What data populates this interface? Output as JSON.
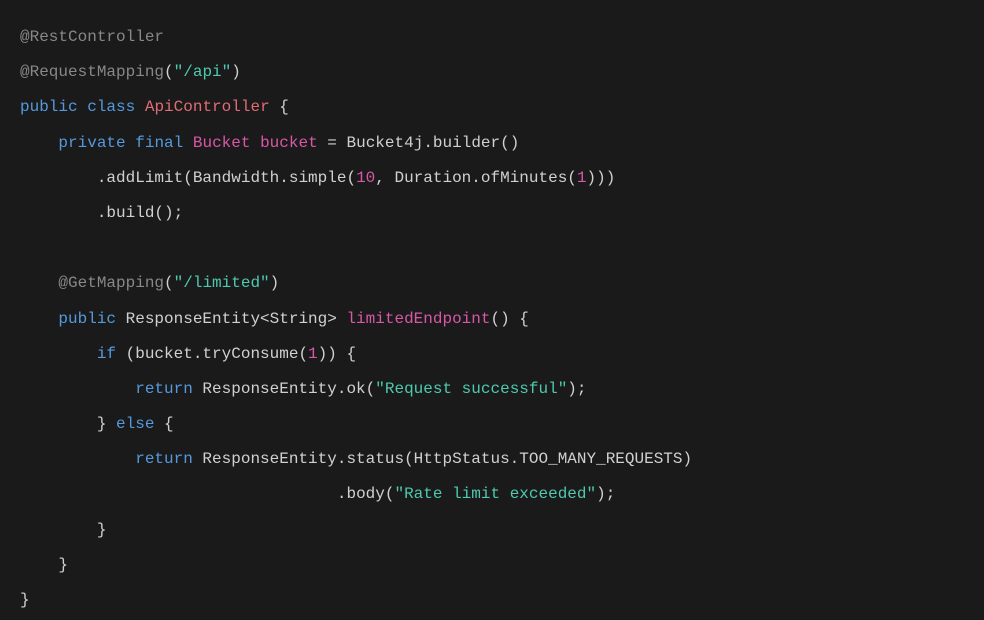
{
  "code": {
    "line1": {
      "annotation": "@RestController"
    },
    "line2": {
      "annotation": "@RequestMapping",
      "paren_open": "(",
      "string": "\"/api\"",
      "paren_close": ")"
    },
    "line3": {
      "keyword_public": "public",
      "keyword_class": "class",
      "class_name": "ApiController",
      "brace": " {"
    },
    "line4": {
      "indent": "    ",
      "keyword_private": "private",
      "keyword_final": "final",
      "type": "Bucket",
      "variable": "bucket",
      "equals": " = ",
      "builder": "Bucket4j.builder()"
    },
    "line5": {
      "indent": "        ",
      "method": ".addLimit(Bandwidth.simple(",
      "num1": "10",
      "mid": ", Duration.ofMinutes(",
      "num2": "1",
      "end": ")))"
    },
    "line6": {
      "indent": "        ",
      "method": ".build();"
    },
    "line8": {
      "indent": "    ",
      "annotation": "@GetMapping",
      "paren_open": "(",
      "string": "\"/limited\"",
      "paren_close": ")"
    },
    "line9": {
      "indent": "    ",
      "keyword_public": "public",
      "type": " ResponseEntity<String> ",
      "method_name": "limitedEndpoint",
      "parens": "() {"
    },
    "line10": {
      "indent": "        ",
      "keyword_if": "if",
      "condition_start": " (bucket.tryConsume(",
      "num": "1",
      "condition_end": ")) {"
    },
    "line11": {
      "indent": "            ",
      "keyword_return": "return",
      "call": " ResponseEntity.ok(",
      "string": "\"Request successful\"",
      "end": ");"
    },
    "line12": {
      "indent": "        ",
      "close_brace": "}",
      "keyword_else": " else ",
      "open_brace": "{"
    },
    "line13": {
      "indent": "            ",
      "keyword_return": "return",
      "call": " ResponseEntity.status(HttpStatus.TOO_MANY_REQUESTS)"
    },
    "line14": {
      "indent": "                                 ",
      "method": ".body(",
      "string": "\"Rate limit exceeded\"",
      "end": ");"
    },
    "line15": {
      "indent": "        ",
      "brace": "}"
    },
    "line16": {
      "indent": "    ",
      "brace": "}"
    },
    "line17": {
      "brace": "}"
    }
  }
}
